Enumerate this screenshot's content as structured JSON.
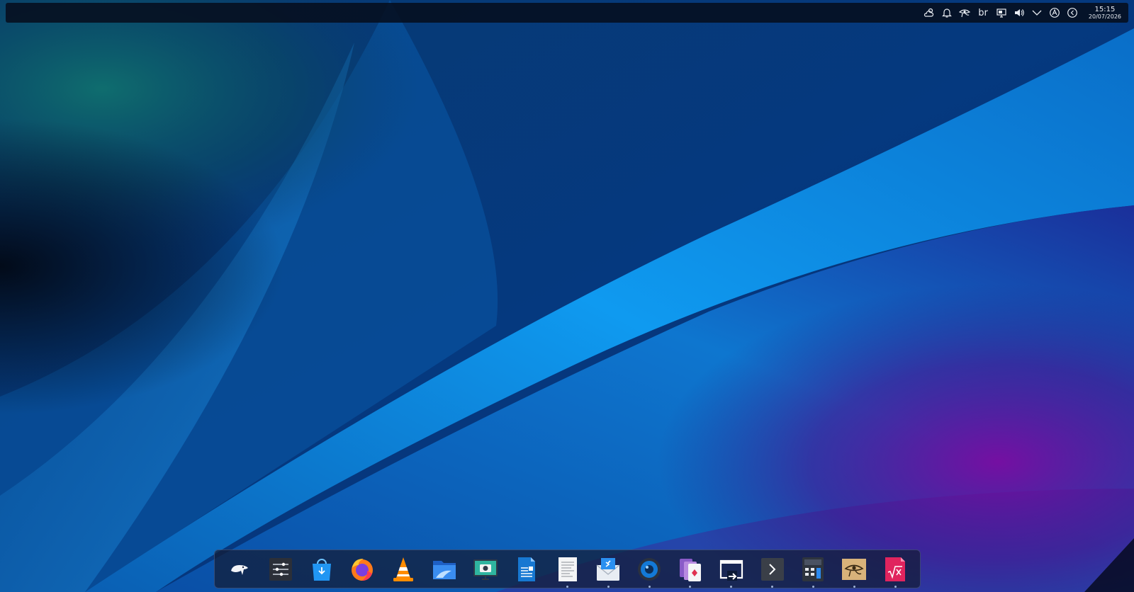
{
  "top_panel": {
    "tray_icons": [
      "weather-cloud-sun-icon",
      "notifications-bell-icon",
      "eye-of-horus-icon",
      "display-configuration-icon",
      "volume-speaker-icon",
      "expand-tray-chevron-icon",
      "account-circle-icon",
      "power-clock-icon"
    ],
    "keyboard_layout": "br",
    "clock": {
      "time": "15:15",
      "date": "20/07/2026"
    }
  },
  "dock": {
    "items": [
      {
        "icon": "app-launcher-icon",
        "running": false
      },
      {
        "icon": "system-settings-icon",
        "running": false
      },
      {
        "icon": "software-store-icon",
        "running": false
      },
      {
        "icon": "firefox-browser-icon",
        "running": false
      },
      {
        "icon": "vlc-media-player-icon",
        "running": false
      },
      {
        "icon": "file-manager-icon",
        "running": false
      },
      {
        "icon": "screenshot-tool-icon",
        "running": false
      },
      {
        "icon": "document-writer-icon",
        "running": false
      },
      {
        "icon": "text-editor-icon",
        "running": true
      },
      {
        "icon": "email-client-icon",
        "running": true
      },
      {
        "icon": "screen-capture-lens-icon",
        "running": true
      },
      {
        "icon": "card-game-icon",
        "running": true
      },
      {
        "icon": "window-switch-icon",
        "running": true
      },
      {
        "icon": "terminal-icon",
        "running": true
      },
      {
        "icon": "calculator-icon",
        "running": true
      },
      {
        "icon": "papyrus-eye-icon",
        "running": true
      },
      {
        "icon": "math-formula-icon",
        "running": true
      }
    ]
  },
  "colors": {
    "wallpaper_base": "#06337a",
    "wallpaper_highlight": "#0f9af0",
    "wallpaper_teal": "#0f6d6e",
    "wallpaper_purple": "#6a0f9c",
    "panel_bg": "#060e1e",
    "dock_bg": "#141c34"
  }
}
